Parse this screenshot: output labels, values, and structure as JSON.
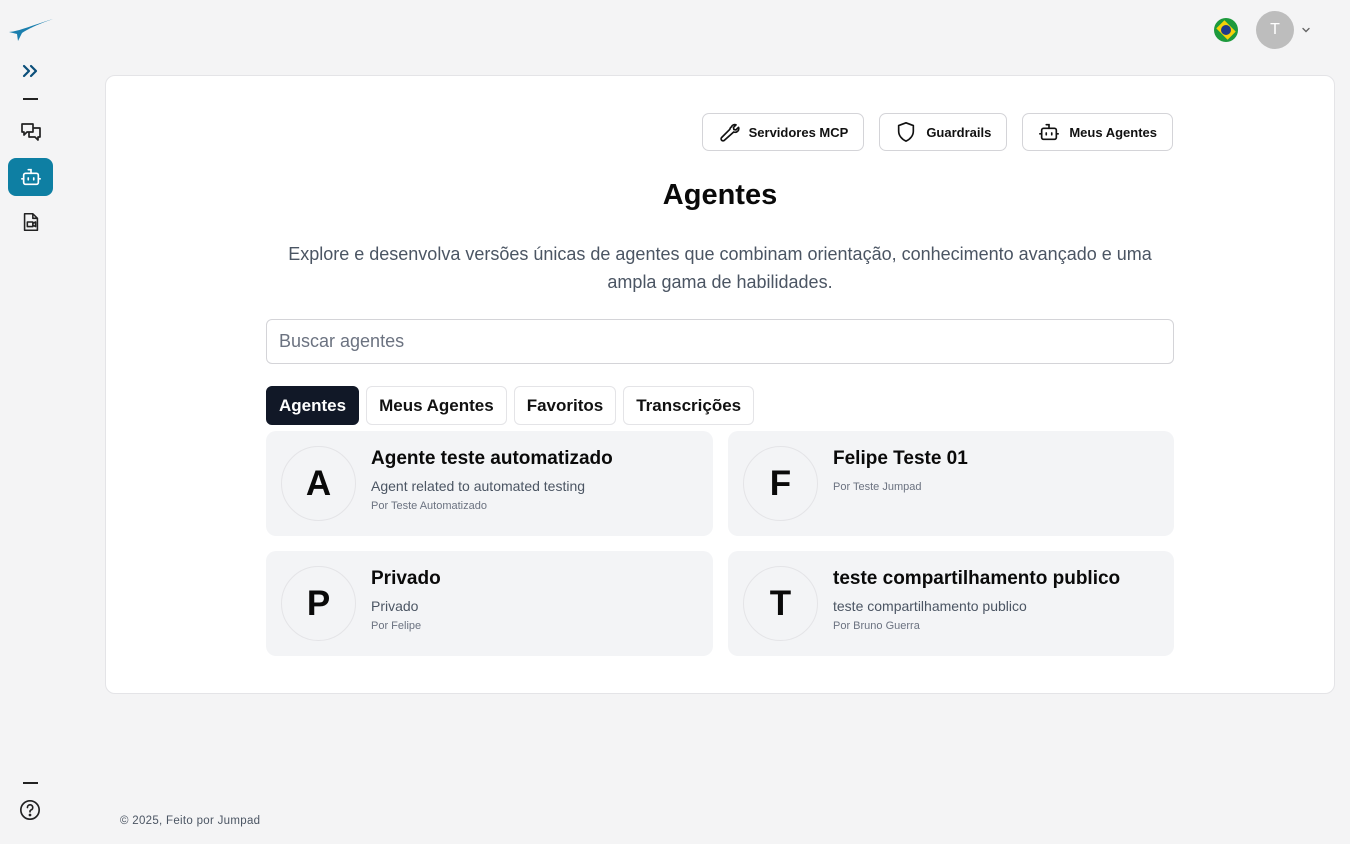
{
  "header": {
    "avatar_initial": "T",
    "flag_icon": "brazil-flag-icon"
  },
  "colors": {
    "accent": "#0e7fa3",
    "active_tab": "#111827",
    "background": "#f4f4f5"
  },
  "top_actions": [
    {
      "label": "Servidores MCP",
      "icon": "wrench-icon"
    },
    {
      "label": "Guardrails",
      "icon": "shield-icon"
    },
    {
      "label": "Meus Agentes",
      "icon": "robot-icon"
    }
  ],
  "main": {
    "title": "Agentes",
    "description": "Explore e desenvolva versões únicas de agentes que combinam orientação, conhecimento avançado e uma ampla gama de habilidades.",
    "search_placeholder": "Buscar agentes"
  },
  "tabs": [
    {
      "label": "Agentes",
      "active": true
    },
    {
      "label": "Meus Agentes",
      "active": false
    },
    {
      "label": "Favoritos",
      "active": false
    },
    {
      "label": "Transcrições",
      "active": false
    }
  ],
  "agents": [
    {
      "letter": "A",
      "name": "Agente teste automatizado",
      "description": "Agent related to automated testing",
      "by": "Por Teste Automatizado"
    },
    {
      "letter": "F",
      "name": "Felipe Teste 01",
      "description": "",
      "by": "Por Teste Jumpad"
    },
    {
      "letter": "P",
      "name": "Privado",
      "description": "Privado",
      "by": "Por Felipe"
    },
    {
      "letter": "T",
      "name": "teste compartilhamento publico",
      "description": "teste compartilhamento publico",
      "by": "Por Bruno Guerra"
    }
  ],
  "footer": {
    "text": "© 2025, Feito por Jumpad"
  }
}
